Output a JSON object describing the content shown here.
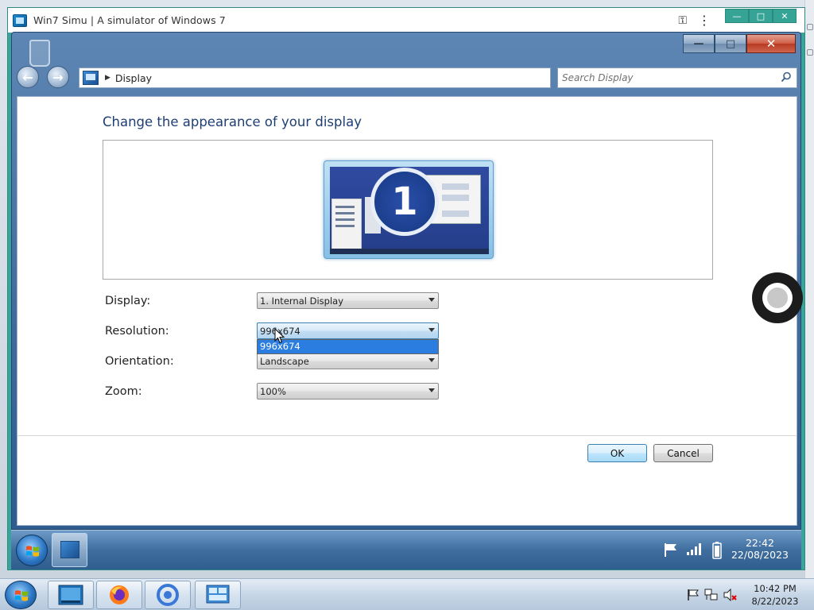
{
  "app": {
    "title": "Win7 Simu | A simulator of Windows 7",
    "controls": {
      "minimize": "—",
      "maximize": "□",
      "close": "✕"
    }
  },
  "window": {
    "breadcrumb": "Display",
    "search_placeholder": "Search Display"
  },
  "display_settings": {
    "heading": "Change the appearance of your display",
    "monitor_number": "1",
    "fields": {
      "display": {
        "label": "Display:",
        "value": "1. Internal Display"
      },
      "resolution": {
        "label": "Resolution:",
        "value": "996x674",
        "dropdown_option": "996x674"
      },
      "orientation": {
        "label": "Orientation:",
        "value": "Landscape"
      },
      "zoom": {
        "label": "Zoom:",
        "value": "100%"
      }
    },
    "buttons": {
      "ok": "OK",
      "cancel": "Cancel"
    }
  },
  "sim_taskbar": {
    "clock_time": "22:42",
    "clock_date": "22/08/2023"
  },
  "host_taskbar": {
    "clock_time": "10:42 PM",
    "clock_date": "8/22/2023"
  },
  "colors": {
    "accent": "#2b7de0",
    "heading": "#1e3f73",
    "app_frame": "#3aa39a"
  }
}
